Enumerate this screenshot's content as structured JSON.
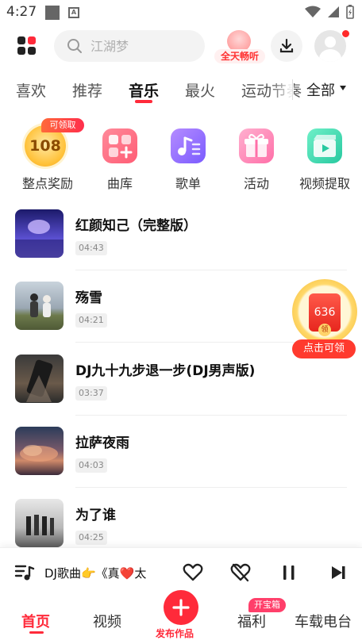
{
  "status_bar": {
    "time": "4:27"
  },
  "header": {
    "search_placeholder": "江湖梦",
    "promo_label": "全天畅听"
  },
  "tabs": {
    "items": [
      "喜欢",
      "推荐",
      "音乐",
      "最火",
      "运动节奏"
    ],
    "active": "音乐",
    "all_label": "全部"
  },
  "categories": [
    {
      "label": "整点奖励",
      "coin_value": "108",
      "badge": "可领取",
      "icon": "coin-icon"
    },
    {
      "label": "曲库",
      "icon": "library-icon"
    },
    {
      "label": "歌单",
      "icon": "playlist-icon"
    },
    {
      "label": "活动",
      "icon": "gift-icon"
    },
    {
      "label": "视频提取",
      "icon": "video-extract-icon"
    }
  ],
  "songs": [
    {
      "title": "红颜知己（完整版）",
      "duration": "04:43"
    },
    {
      "title": "殇雪",
      "duration": "04:21"
    },
    {
      "title": "DJ九十九步退一步(DJ男声版)",
      "duration": "03:37"
    },
    {
      "title": "拉萨夜雨",
      "duration": "04:03"
    },
    {
      "title": "为了谁",
      "duration": "04:25"
    }
  ],
  "red_packet": {
    "value": "636",
    "coin_char": "领",
    "button": "点击可领"
  },
  "player": {
    "now_playing": "DJ歌曲👉《真❤️太"
  },
  "bottom_nav": {
    "home": "首页",
    "video": "视频",
    "publish": "发布作品",
    "welfare": "福利",
    "welfare_badge": "开宝箱",
    "car_radio": "车载电台"
  },
  "colors": {
    "accent": "#ff2a3a",
    "text": "#222222"
  }
}
